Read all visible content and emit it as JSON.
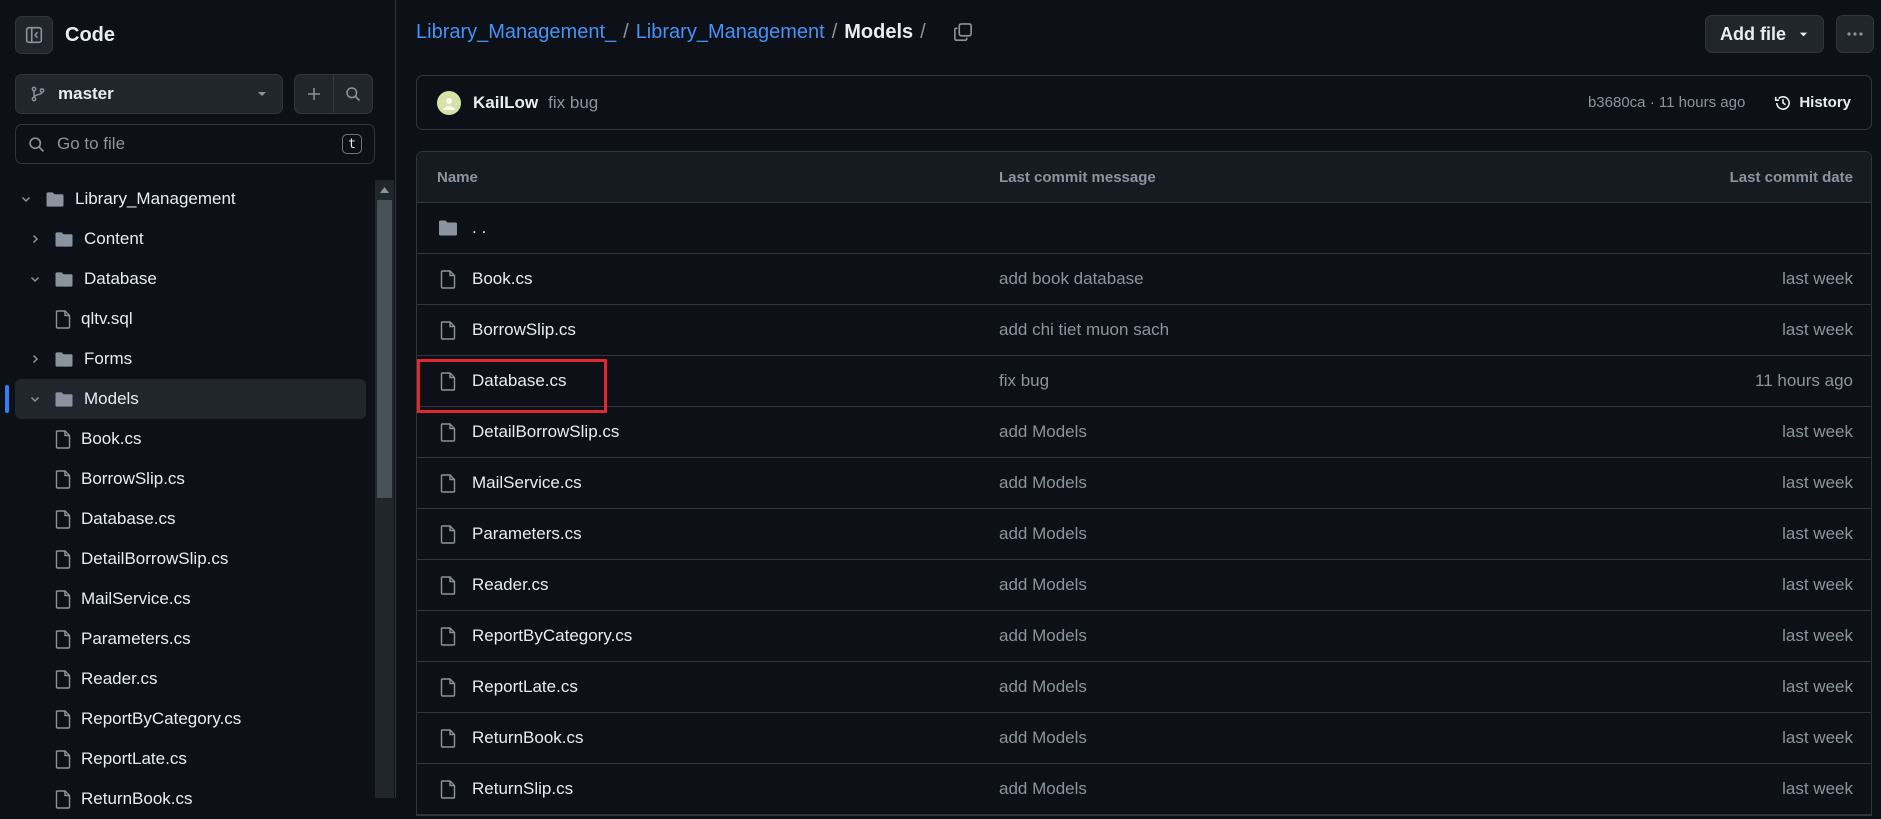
{
  "sidebar": {
    "title": "Code",
    "branch": "master",
    "goto": {
      "placeholder": "Go to file",
      "shortcut": "t"
    },
    "tree": [
      {
        "label": "Library_Management",
        "type": "folder",
        "depth": 0,
        "expanded": true
      },
      {
        "label": "Content",
        "type": "folder",
        "depth": 1,
        "expanded": false
      },
      {
        "label": "Database",
        "type": "folder",
        "depth": 1,
        "expanded": true
      },
      {
        "label": "qltv.sql",
        "type": "file",
        "depth": 2
      },
      {
        "label": "Forms",
        "type": "folder",
        "depth": 1,
        "expanded": false
      },
      {
        "label": "Models",
        "type": "folder",
        "depth": 1,
        "expanded": true,
        "active": true
      },
      {
        "label": "Book.cs",
        "type": "file",
        "depth": 2
      },
      {
        "label": "BorrowSlip.cs",
        "type": "file",
        "depth": 2
      },
      {
        "label": "Database.cs",
        "type": "file",
        "depth": 2
      },
      {
        "label": "DetailBorrowSlip.cs",
        "type": "file",
        "depth": 2
      },
      {
        "label": "MailService.cs",
        "type": "file",
        "depth": 2
      },
      {
        "label": "Parameters.cs",
        "type": "file",
        "depth": 2
      },
      {
        "label": "Reader.cs",
        "type": "file",
        "depth": 2
      },
      {
        "label": "ReportByCategory.cs",
        "type": "file",
        "depth": 2
      },
      {
        "label": "ReportLate.cs",
        "type": "file",
        "depth": 2
      },
      {
        "label": "ReturnBook.cs",
        "type": "file",
        "depth": 2
      }
    ]
  },
  "breadcrumb": {
    "links": [
      "Library_Management_",
      "Library_Management"
    ],
    "current": "Models",
    "trailing_sep": "/"
  },
  "toolbar": {
    "add_file_label": "Add file"
  },
  "commit": {
    "user": "KailLow",
    "message": "fix bug",
    "meta": "b3680ca · 11 hours ago",
    "history_label": "History"
  },
  "table": {
    "headers": {
      "name": "Name",
      "message": "Last commit message",
      "date": "Last commit date"
    },
    "parent_label": ". .",
    "rows": [
      {
        "name": "Book.cs",
        "message": "add book database",
        "date": "last week"
      },
      {
        "name": "BorrowSlip.cs",
        "message": "add chi tiet muon sach",
        "date": "last week"
      },
      {
        "name": "Database.cs",
        "message": "fix bug",
        "date": "11 hours ago",
        "highlighted": true
      },
      {
        "name": "DetailBorrowSlip.cs",
        "message": "add Models",
        "date": "last week"
      },
      {
        "name": "MailService.cs",
        "message": "add Models",
        "date": "last week"
      },
      {
        "name": "Parameters.cs",
        "message": "add Models",
        "date": "last week"
      },
      {
        "name": "Reader.cs",
        "message": "add Models",
        "date": "last week"
      },
      {
        "name": "ReportByCategory.cs",
        "message": "add Models",
        "date": "last week"
      },
      {
        "name": "ReportLate.cs",
        "message": "add Models",
        "date": "last week"
      },
      {
        "name": "ReturnBook.cs",
        "message": "add Models",
        "date": "last week"
      },
      {
        "name": "ReturnSlip.cs",
        "message": "add Models",
        "date": "last week"
      }
    ]
  },
  "colors": {
    "background": "#0d1117",
    "border": "#30363d",
    "link": "#4493f8",
    "muted": "#8b949e",
    "highlight": "#e0282e",
    "active_indicator": "#2f81f7"
  }
}
